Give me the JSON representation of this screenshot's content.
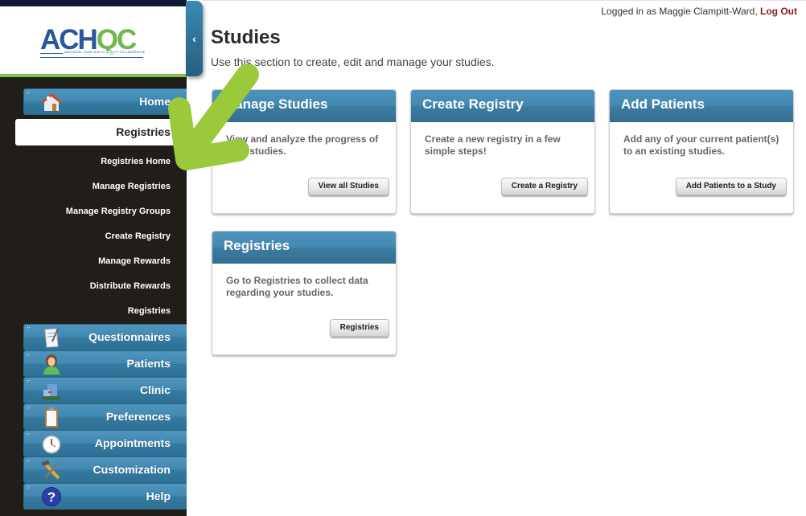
{
  "app": {
    "logo_text_a": "ACH",
    "logo_text_b": "QC",
    "logo_tagline": "ABDOMINAL CORE HEALTH QUALITY COLLABORATIVE",
    "collapse_glyph": "‹"
  },
  "header": {
    "logged_in_prefix": "Logged in as Maggie Clampitt-Ward, ",
    "logout_label": "Log Out"
  },
  "sidebar": {
    "items": [
      {
        "label": "Home",
        "icon": "house-icon"
      },
      {
        "label": "Questionnaires",
        "icon": "document-pen-icon"
      },
      {
        "label": "Patients",
        "icon": "person-icon"
      },
      {
        "label": "Clinic",
        "icon": "building-icon"
      },
      {
        "label": "Preferences",
        "icon": "clipboard-icon"
      },
      {
        "label": "Appointments",
        "icon": "clock-icon"
      },
      {
        "label": "Customization",
        "icon": "tools-icon"
      },
      {
        "label": "Help",
        "icon": "help-icon"
      }
    ],
    "active": {
      "label": "Registries"
    },
    "subitems": [
      "Registries Home",
      "Manage Registries",
      "Manage Registry Groups",
      "Create Registry",
      "Manage Rewards",
      "Distribute Rewards",
      "Registries"
    ]
  },
  "main": {
    "title": "Studies",
    "subtitle": "Use this section to create, edit and manage your studies.",
    "cards": [
      {
        "title": "Manage Studies",
        "description": "View and analyze the progress of your studies.",
        "button": "View all Studies"
      },
      {
        "title": "Create Registry",
        "description": "Create a new registry in a few simple steps!",
        "button": "Create a Registry"
      },
      {
        "title": "Add Patients",
        "description": "Add any of your current patient(s) to an existing studies.",
        "button": "Add Patients to a Study"
      },
      {
        "title": "Registries",
        "description": "Go to Registries to collect data regarding your studies.",
        "button": "Registries"
      }
    ]
  },
  "colors": {
    "accent_blue": "#4189b3",
    "logo_blue": "#28579c",
    "logo_green": "#6cbb4a",
    "arrow_green": "#9ac93b",
    "logout_red": "#8b1a1a",
    "sidebar_bg": "#211e1a"
  }
}
